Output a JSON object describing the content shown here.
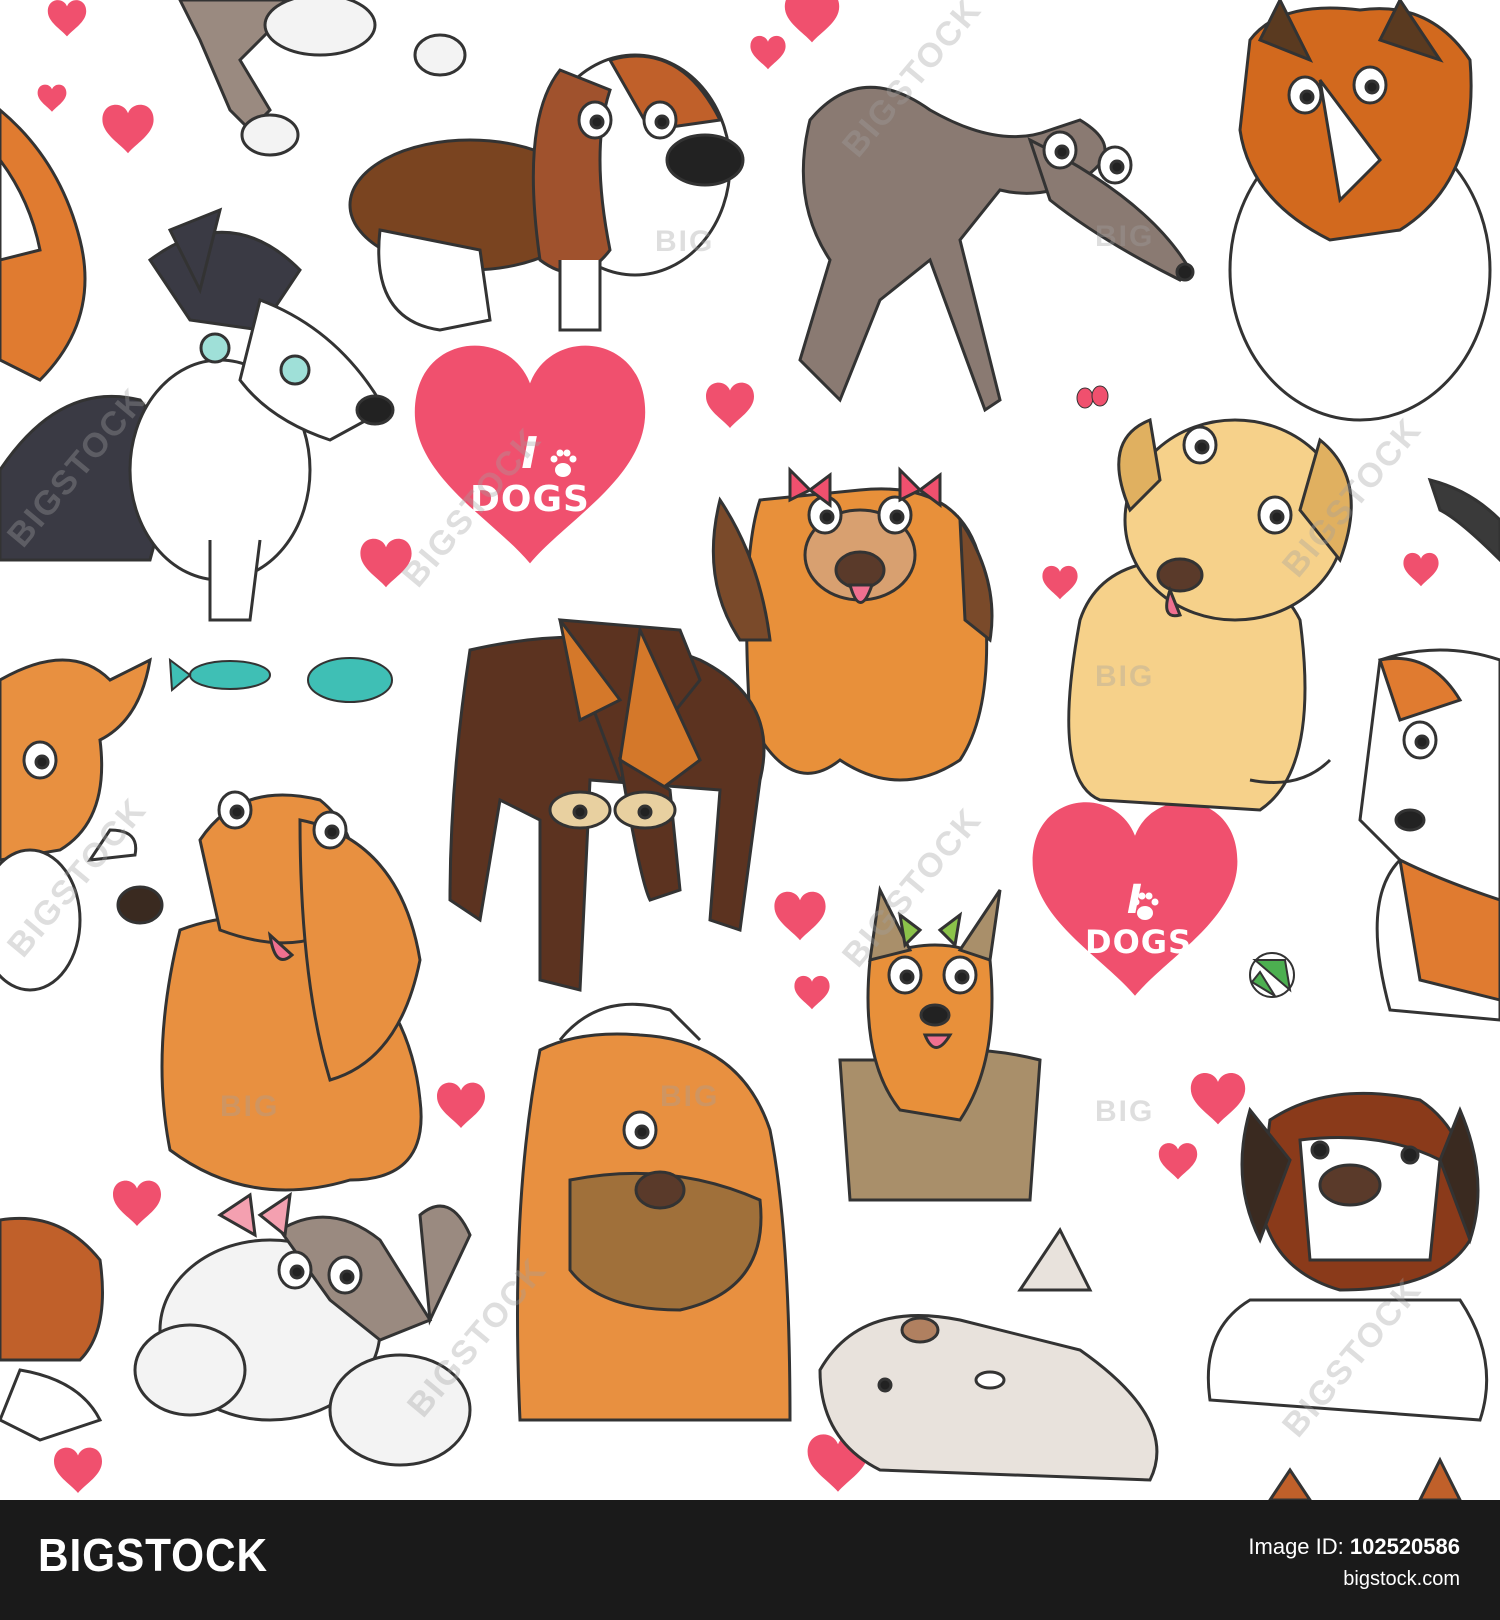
{
  "colors": {
    "background": "#ffffff",
    "heart": "#f0506e",
    "footer_bg": "#1a1a1a",
    "footer_text": "#ffffff",
    "watermark": "#a0a0a0"
  },
  "hearts": {
    "big_heart_1": {
      "line1": "I",
      "line2": "DOGS",
      "icon": "paw-print-icon"
    },
    "big_heart_2": {
      "line1": "I",
      "line2": "DOGS",
      "icon": "paw-print-icon"
    }
  },
  "watermarks": {
    "rotated": "BIGSTOCK",
    "small": "BIG"
  },
  "illustration": {
    "subjects": [
      "poodle-dog",
      "beagle-dog",
      "greyhound-dog",
      "collie-dog",
      "husky-dog",
      "pekingese-dog",
      "labrador-dog",
      "doberman-dog",
      "cocker-spaniel-dog",
      "yorkshire-terrier-dog",
      "shar-pei-dog",
      "bull-terrier-dog",
      "st-bernard-dog",
      "jack-russell-dog",
      "corgi-dog",
      "chihuahua-dog",
      "fish-toy",
      "ball-toy",
      "butterfly"
    ]
  },
  "footer": {
    "logo": "BIGSTOCK",
    "image_id_label": "Image ID: ",
    "image_id_value": "102520586",
    "site": "bigstock.com"
  }
}
